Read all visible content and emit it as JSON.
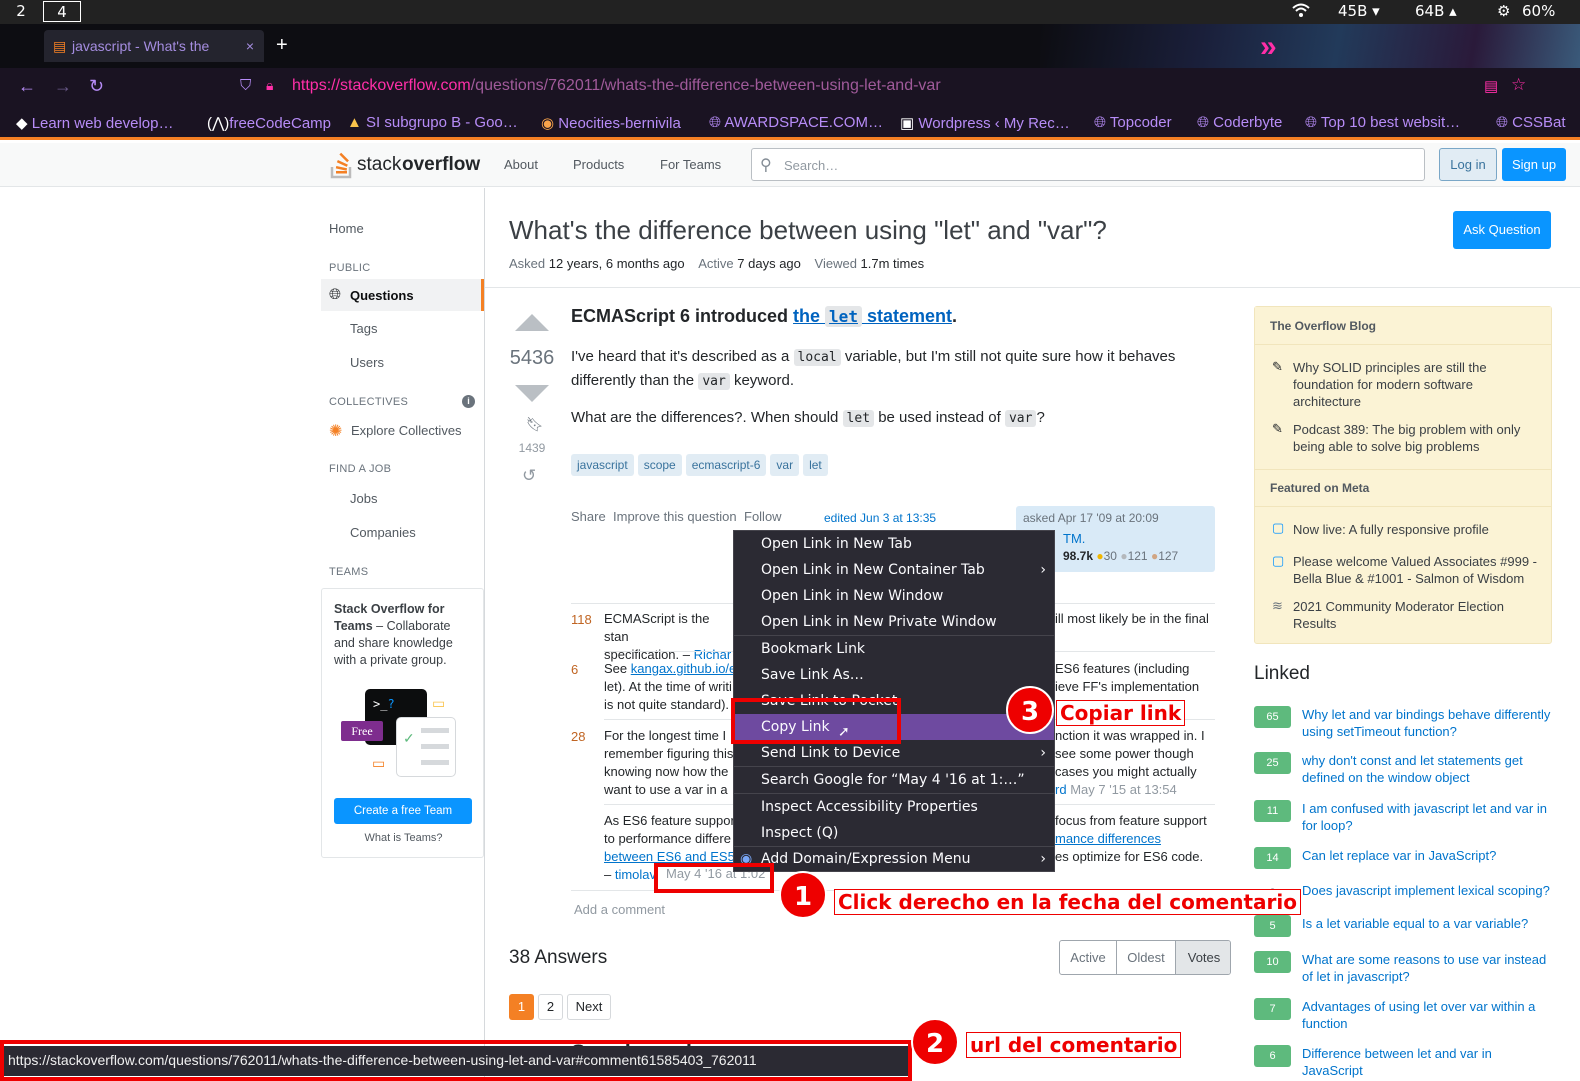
{
  "system": {
    "workspaces": [
      "2",
      "4"
    ],
    "wifi": "",
    "net_down": "45B",
    "net_up": "64B",
    "battery": "60%"
  },
  "browser": {
    "tab_title": "javascript - What's the",
    "url_host": "https://stackoverflow.com",
    "url_path": "/questions/762011/whats-the-difference-between-using-let-and-var",
    "bookmarks": [
      "Learn web develop…",
      "freeCodeCamp",
      "SI subgrupo B - Goo…",
      "Neocities-bernivila",
      "AWARDSPACE.COM…",
      "Wordpress ‹ My Rec…",
      "Topcoder",
      "Coderbyte",
      "Top 10 best websit…",
      "CSSBat"
    ]
  },
  "so": {
    "logo_a": "stack",
    "logo_b": "overflow",
    "nav": [
      "About",
      "Products",
      "For Teams"
    ],
    "search_placeholder": "Search…",
    "login": "Log in",
    "signup": "Sign up",
    "left": {
      "home": "Home",
      "public": "PUBLIC",
      "questions": "Questions",
      "tags": "Tags",
      "users": "Users",
      "collectives": "COLLECTIVES",
      "explore": "Explore Collectives",
      "findjob": "FIND A JOB",
      "jobs": "Jobs",
      "companies": "Companies",
      "teams": "TEAMS",
      "teams_title": "Stack Overflow for Teams",
      "teams_desc": " – Collaborate and share knowledge with a private group.",
      "free": "Free",
      "create_team": "Create a free Team",
      "what_teams": "What is Teams?"
    },
    "question": {
      "title": "What's the difference between using \"let\" and \"var\"?",
      "ask_button": "Ask Question",
      "asked_label": "Asked",
      "asked": "12 years, 6 months ago",
      "active_label": "Active",
      "active": "7 days ago",
      "viewed_label": "Viewed",
      "viewed": "1.7m times",
      "score": "5436",
      "bookmarks": "1439",
      "h_pre": "ECMAScript 6 introduced ",
      "h_link1": "the ",
      "h_code": "let",
      "h_link2": " statement",
      "h_post": ".",
      "p1_a": "I've heard that it's described as a ",
      "p1_code": "local",
      "p1_b": " variable, but I'm still not quite sure how it behaves differently than the ",
      "p1_code2": "var",
      "p1_c": " keyword.",
      "p2_a": "What are the differences?. When should ",
      "p2_code": "let",
      "p2_b": " be used instead of ",
      "p2_code2": "var",
      "p2_c": "?",
      "tags": [
        "javascript",
        "scope",
        "ecmascript-6",
        "var",
        "let"
      ],
      "share": "Share",
      "improve": "Improve this question",
      "follow": "Follow",
      "edited": "edited Jun 3 at 13:35",
      "asked_card": "asked Apr 17 '09 at 20:09",
      "user": "TM.",
      "rep": "98.7k",
      "gold": "30",
      "silver": "121",
      "bronze": "127"
    },
    "comments": [
      {
        "score": "118",
        "text": "ECMAScript is the stan",
        "tail": "ill most likely be in the final",
        "line2": "specification. – ",
        "user": "Richar"
      },
      {
        "score": "6",
        "pre": "See ",
        "link": "kangax.github.io/e",
        "tail": "ES6 features (including",
        "line2": "let). At the time of writi",
        "tail2": "ieve FF's implementation",
        "line3": "is not quite standard)."
      },
      {
        "score": "28",
        "text": "For the longest time I",
        "tail": "nction it was wrapped in. I",
        "line2": "remember figuring this",
        "tail2": "see some power though",
        "line3": "knowing now how the",
        "tail3": "cases you might actually",
        "line4": "want to use a var in a",
        "user4": "rd",
        "date4": "May 7 '15 at 13:54"
      },
      {
        "text": "As ES6 feature suppor",
        "tail": "focus from feature support",
        "line2": "to performance differe",
        "link2": "mance differences",
        "line3": "between ES6 and ES5",
        "tail3": "es optimize for ES6 code.",
        "user": "timolav",
        "date": "May 4 '16 at 1:02"
      }
    ],
    "add_comment": "Add a comment",
    "answers": "38 Answers",
    "sort": [
      "Active",
      "Oldest",
      "Votes"
    ],
    "pages": [
      "1",
      "2",
      "Next"
    ],
    "scoping": "Scoping rules",
    "blog": {
      "title": "The Overflow Blog",
      "items": [
        "Why SOLID principles are still the foundation for modern software architecture",
        "Podcast 389: The big problem with only being able to solve big problems"
      ],
      "meta_title": "Featured on Meta",
      "meta": [
        "Now live: A fully responsive profile",
        "Please welcome Valued Associates #999 - Bella Blue & #1001 - Salmon of Wisdom",
        "2021 Community Moderator Election Results"
      ]
    },
    "linked_title": "Linked",
    "linked": [
      {
        "n": "65",
        "t": "Why let and var bindings behave differently using setTimeout function?"
      },
      {
        "n": "25",
        "t": "why don't const and let statements get defined on the window object"
      },
      {
        "n": "11",
        "t": "I am confused with javascript let and var in for loop?"
      },
      {
        "n": "14",
        "t": "Can let replace var in JavaScript?"
      },
      {
        "n": "8",
        "t": "Does javascript implement lexical scoping?"
      },
      {
        "n": "5",
        "t": "Is a let variable equal to a var variable?"
      },
      {
        "n": "10",
        "t": "What are some reasons to use var instead of let in javascript?"
      },
      {
        "n": "7",
        "t": "Advantages of using let over var within a function"
      },
      {
        "n": "6",
        "t": "Difference between let and var in JavaScript"
      }
    ]
  },
  "context_menu": [
    {
      "label": "Open Link in New Tab",
      "sub": false
    },
    {
      "label": "Open Link in New Container Tab",
      "sub": true
    },
    {
      "label": "Open Link in New Window",
      "sub": false
    },
    {
      "label": "Open Link in New Private Window",
      "sub": false
    },
    {
      "label": "Bookmark Link",
      "sub": false
    },
    {
      "label": "Save Link As…",
      "sub": false
    },
    {
      "label": "Save Link to Pocket",
      "sub": false
    },
    {
      "label": "Copy Link",
      "sub": false
    },
    {
      "label": "Send Link to Device",
      "sub": true
    },
    {
      "label": "Search Google for “May 4 '16 at 1:…”",
      "sub": false
    },
    {
      "label": "Inspect Accessibility Properties",
      "sub": false
    },
    {
      "label": "Inspect (Q)",
      "sub": false
    },
    {
      "label": "Add Domain/Expression Menu",
      "sub": true
    }
  ],
  "annotations": {
    "n1": "1",
    "t1": "Click derecho en la fecha del comentario",
    "n2": "2",
    "t2": "url del comentario",
    "n3": "3",
    "t3": "Copiar link"
  },
  "status_url": "https://stackoverflow.com/questions/762011/whats-the-difference-between-using-let-and-var#comment61585403_762011"
}
